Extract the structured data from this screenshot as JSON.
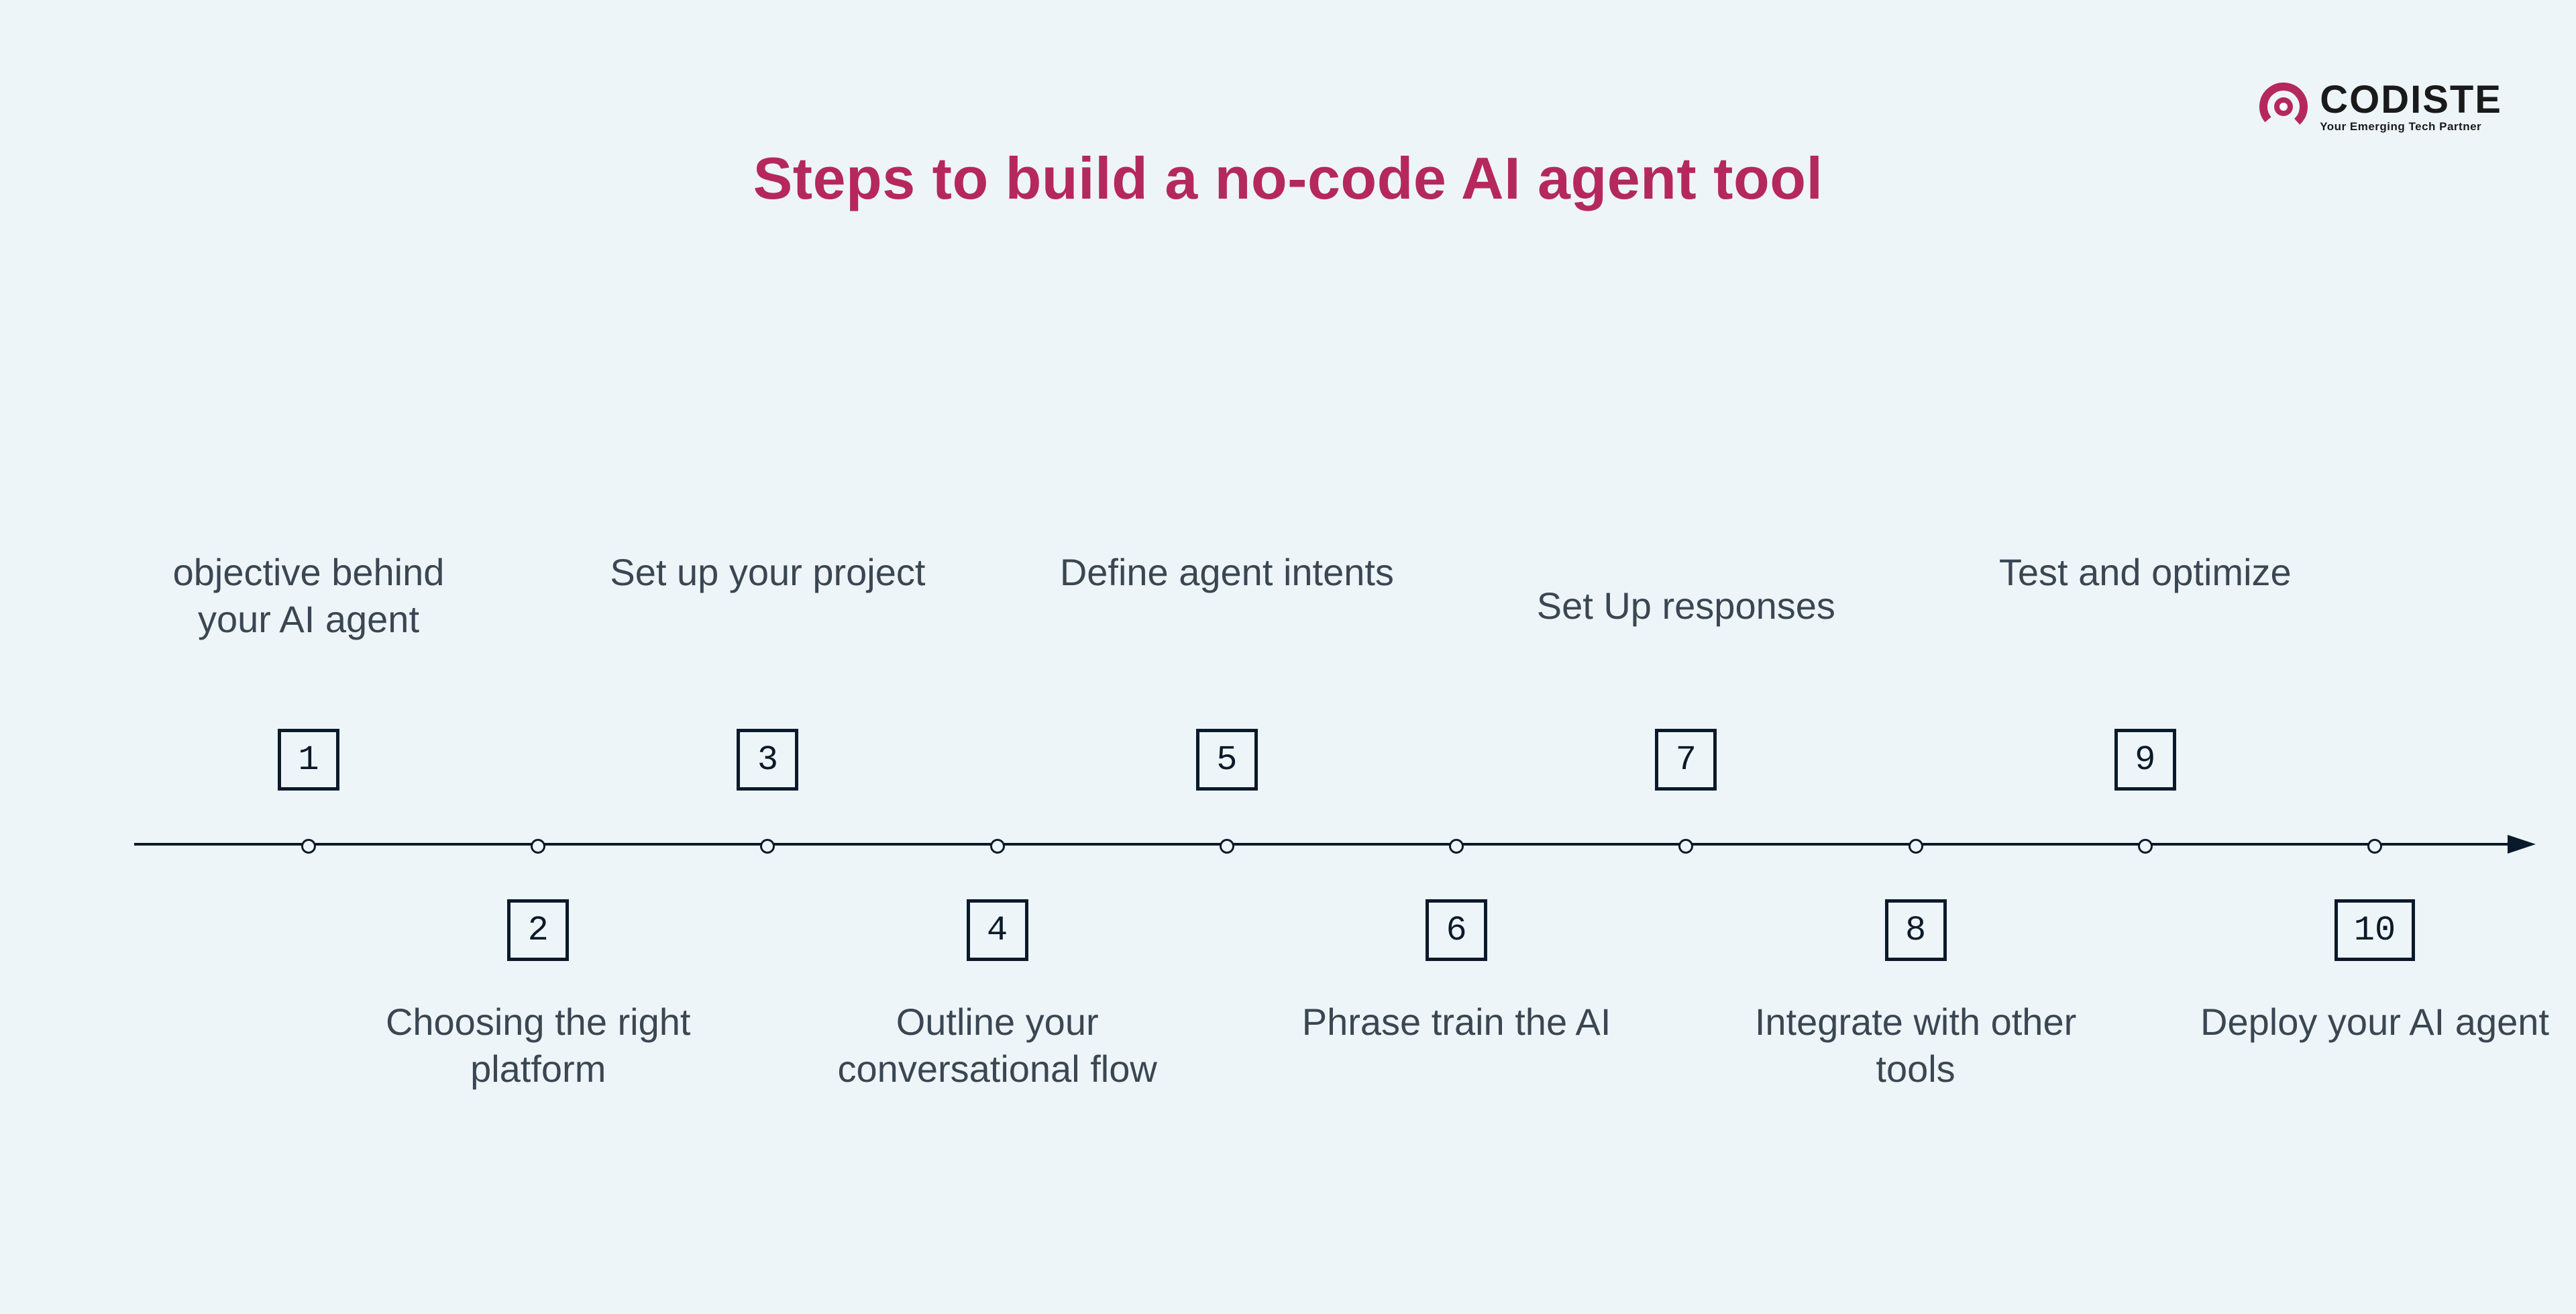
{
  "title": "Steps to build a no-code AI agent tool",
  "logo": {
    "name": "CODISTE",
    "tagline": "Your Emerging Tech Partner"
  },
  "steps": [
    {
      "n": "1",
      "pos": "top",
      "label": "objective behind your AI agent"
    },
    {
      "n": "2",
      "pos": "bottom",
      "label": "Choosing the right platform"
    },
    {
      "n": "3",
      "pos": "top",
      "label": "Set up your project"
    },
    {
      "n": "4",
      "pos": "bottom",
      "label": "Outline your conversational flow"
    },
    {
      "n": "5",
      "pos": "top",
      "label": "Define agent intents"
    },
    {
      "n": "6",
      "pos": "bottom",
      "label": "Phrase train the AI"
    },
    {
      "n": "7",
      "pos": "top",
      "label": "Set Up responses"
    },
    {
      "n": "8",
      "pos": "bottom",
      "label": "Integrate with other tools"
    },
    {
      "n": "9",
      "pos": "top",
      "label": "Test and optimize"
    },
    {
      "n": "10",
      "pos": "bottom",
      "label": "Deploy your AI agent"
    }
  ],
  "chart_data": {
    "type": "table",
    "title": "Steps to build a no-code AI agent tool",
    "categories": [
      "1",
      "2",
      "3",
      "4",
      "5",
      "6",
      "7",
      "8",
      "9",
      "10"
    ],
    "values": [
      "objective behind your AI agent",
      "Choosing the right platform",
      "Set up your project",
      "Outline your conversational flow",
      "Define agent intents",
      "Phrase train the AI",
      "Set Up responses",
      "Integrate with other tools",
      "Test and optimize",
      "Deploy your AI agent"
    ]
  }
}
